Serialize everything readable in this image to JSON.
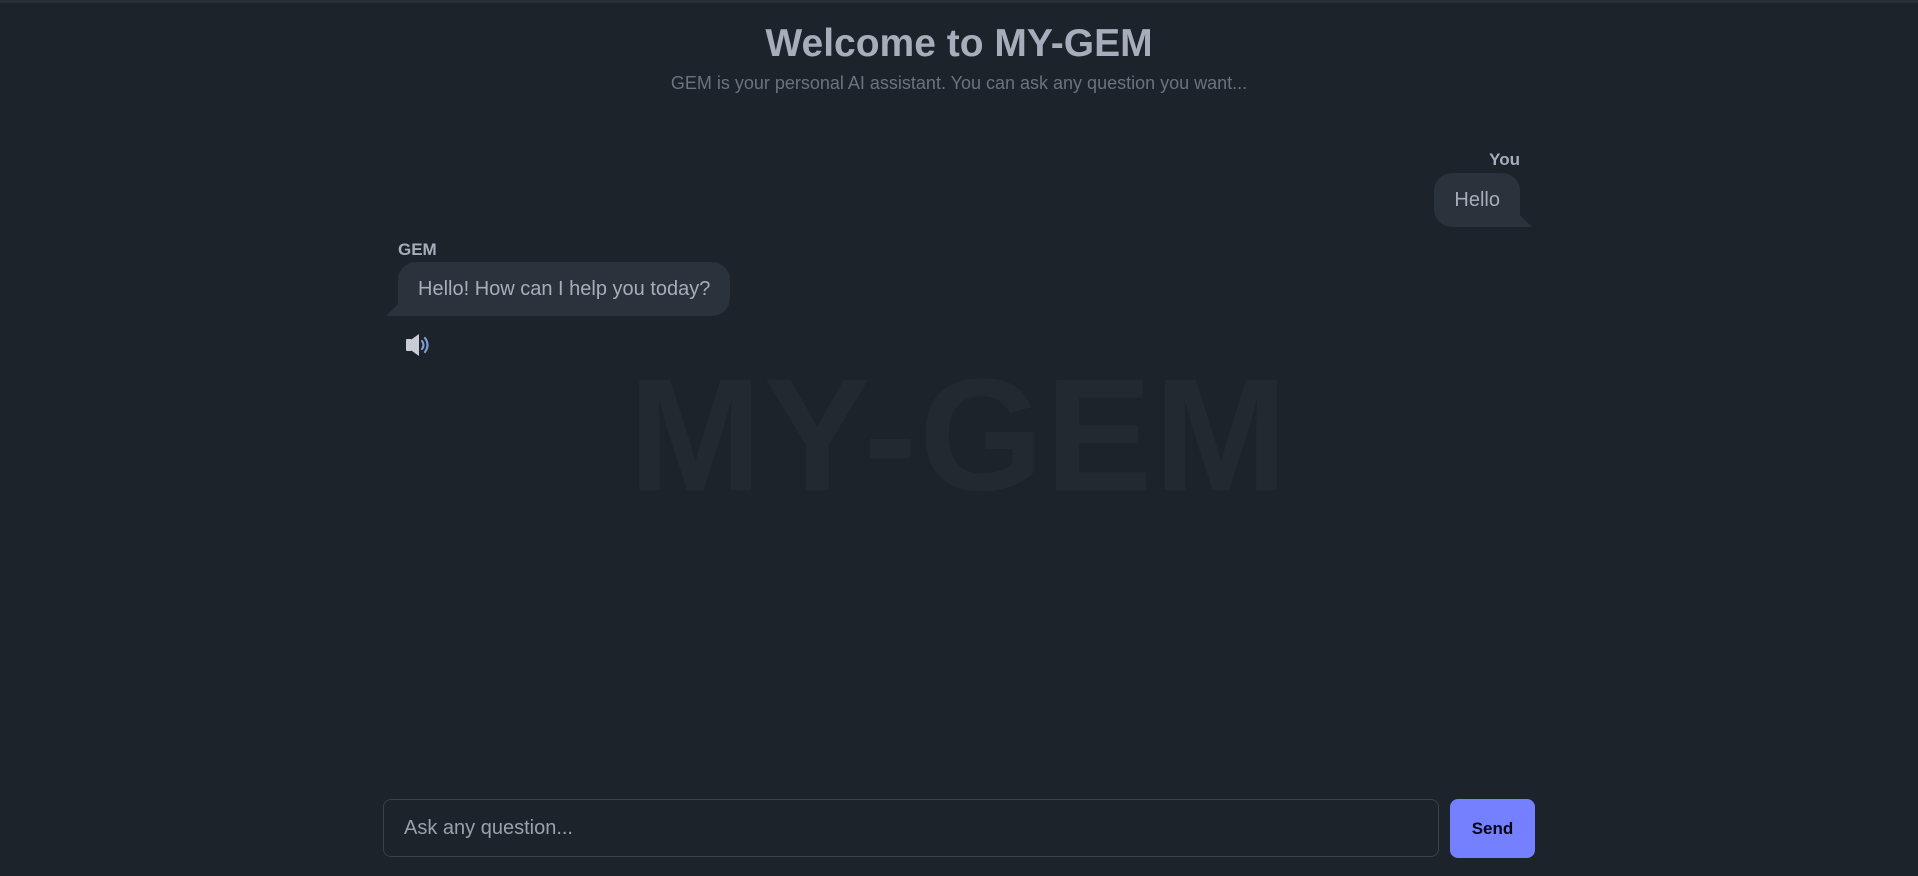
{
  "header": {
    "title": "Welcome to MY-GEM",
    "subtitle": "GEM is your personal AI assistant. You can ask any question you want..."
  },
  "watermark": "MY-GEM",
  "messages": [
    {
      "sender": "You",
      "text": "Hello"
    },
    {
      "sender": "GEM",
      "text": "Hello! How can I help you today?"
    }
  ],
  "composer": {
    "placeholder": "Ask any question...",
    "value": "",
    "send_label": "Send"
  },
  "icons": {
    "speaker": "speaker-icon"
  },
  "colors": {
    "background": "#1d232a",
    "bubble": "#2a323c",
    "text": "#a6adbb",
    "accent": "#7480ff"
  }
}
